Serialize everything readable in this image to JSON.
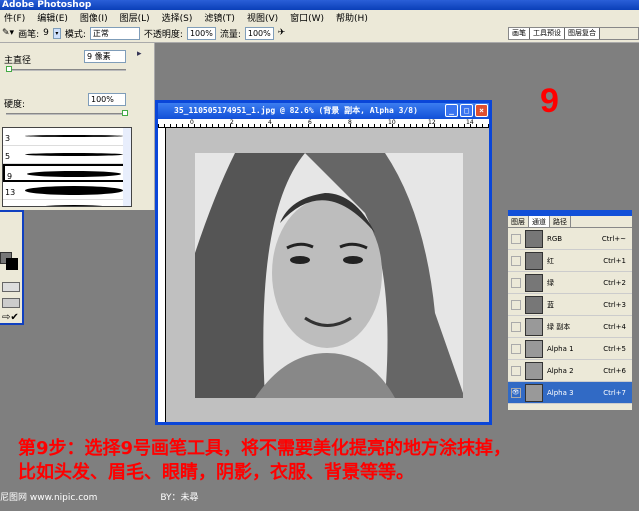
{
  "app": {
    "title": "Adobe Photoshop"
  },
  "menu": [
    "件(F)",
    "编辑(E)",
    "图像(I)",
    "图层(L)",
    "选择(S)",
    "滤镜(T)",
    "视图(V)",
    "窗口(W)",
    "帮助(H)"
  ],
  "options": {
    "brush_label": "画笔:",
    "brush_size": "9",
    "mode_label": "模式:",
    "mode_value": "正常",
    "opacity_label": "不透明度:",
    "opacity_value": "100%",
    "flow_label": "流量:",
    "flow_value": "100%"
  },
  "palette_well": [
    "画笔",
    "工具预设",
    "图层复合"
  ],
  "brush_panel": {
    "diameter_label": "主直径",
    "diameter_value": "9 像素",
    "hardness_label": "硬度:",
    "hardness_value": "100%",
    "diameter_fraction": 0.03,
    "hardness_fraction": 1.0,
    "presets": [
      "3",
      "5",
      "9",
      "13",
      ""
    ],
    "selected": "9"
  },
  "document": {
    "title": "35_110505174951_1.jpg @ 82.6% (背景 副本, Alpha 3/8)",
    "ruler_ticks": [
      "0",
      "2",
      "4",
      "6",
      "8",
      "10",
      "12",
      "14"
    ]
  },
  "step_number": "9",
  "channels": {
    "tabs": [
      "图层",
      "通道",
      "路径"
    ],
    "active_tab": "通道",
    "rows": [
      {
        "name": "RGB",
        "shortcut": "Ctrl+~"
      },
      {
        "name": "红",
        "shortcut": "Ctrl+1"
      },
      {
        "name": "绿",
        "shortcut": "Ctrl+2"
      },
      {
        "name": "蓝",
        "shortcut": "Ctrl+3"
      },
      {
        "name": "绿 副本",
        "shortcut": "Ctrl+4"
      },
      {
        "name": "Alpha 1",
        "shortcut": "Ctrl+5"
      },
      {
        "name": "Alpha 2",
        "shortcut": "Ctrl+6"
      },
      {
        "name": "Alpha 3",
        "shortcut": "Ctrl+7",
        "selected": true
      }
    ]
  },
  "caption": {
    "line1": "第9步：选择9号画笔工具，将不需要美化提亮的地方涂抹掉，",
    "line2": "比如头发、眉毛、眼睛，阴影，衣服、背景等等。"
  },
  "footer": {
    "site": "尼图网 www.nipic.com",
    "author": "BY：未尋"
  },
  "colors": {
    "accent": "#ff0000",
    "titlebar": "#0a46d8",
    "selection": "#316ac5"
  }
}
